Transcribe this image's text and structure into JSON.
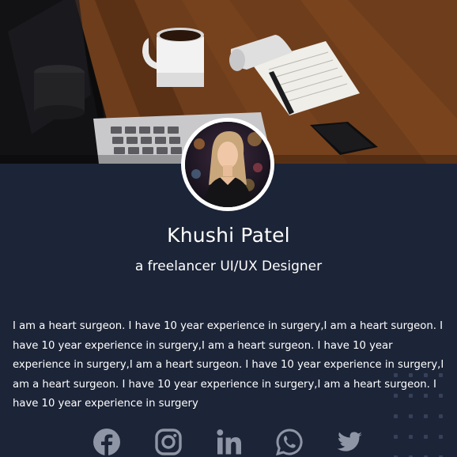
{
  "profile": {
    "name": "Khushi Patel",
    "title": "a freelancer UI/UX Designer",
    "bio": "I am a heart surgeon. I have 10 year experience in surgery,I am a heart surgeon. I have 10 year experience in surgery,I am a heart surgeon. I have 10 year experience in surgery,I am a heart surgeon. I have 10 year experience in surgery,I am a heart surgeon. I have 10 year experience in surgery,I am a heart surgeon. I have 10 year experience in surgery"
  },
  "socials": [
    {
      "icon": "facebook-icon"
    },
    {
      "icon": "instagram-icon"
    },
    {
      "icon": "linkedin-icon"
    },
    {
      "icon": "whatsapp-icon"
    },
    {
      "icon": "twitter-icon"
    }
  ],
  "colors": {
    "background": "#1c2437",
    "text": "#ffffff",
    "icon": "#8e96a6",
    "avatar_ring": "#ffffff"
  }
}
